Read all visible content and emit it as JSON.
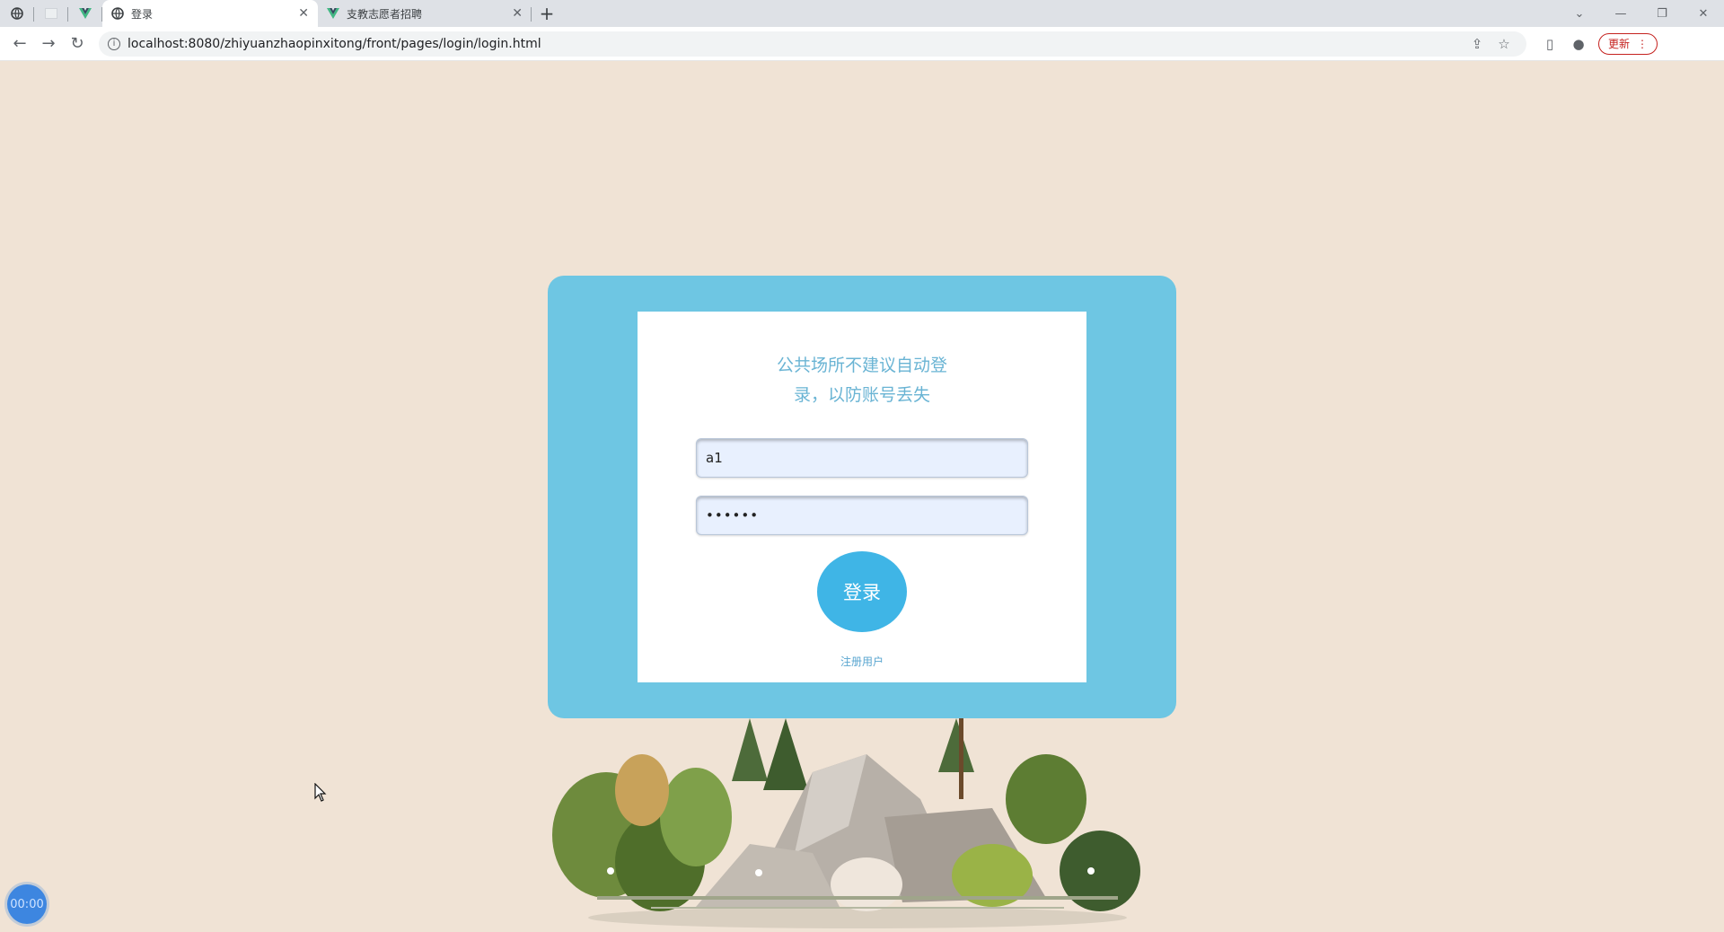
{
  "browser": {
    "tabs": [
      {
        "title": "登录",
        "active": true
      },
      {
        "title": "支教志愿者招聘",
        "active": false
      }
    ],
    "url": "localhost:8080/zhiyuanzhaopinxitong/front/pages/login/login.html",
    "update_label": "更新"
  },
  "login": {
    "notice": "公共场所不建议自动登录，以防账号丢失",
    "username_value": "a1",
    "password_value": "••••••",
    "submit_label": "登录",
    "register_label": "注册用户"
  },
  "recorder": {
    "timer": "00:00"
  },
  "colors": {
    "page_bg": "#f0e3d5",
    "card_outer": "#6ec6e3",
    "button": "#3fb5e6",
    "notice_text": "#6ab4d4"
  }
}
